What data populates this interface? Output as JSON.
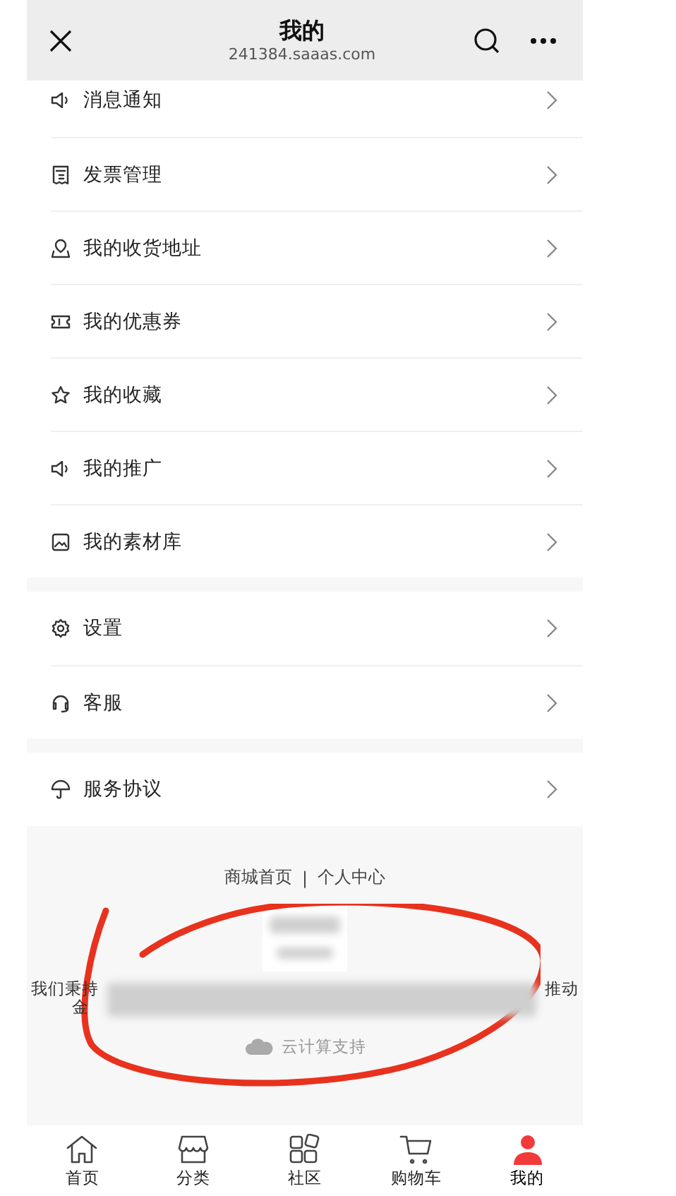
{
  "header": {
    "title": "我的",
    "subtitle": "241384.saaas.com"
  },
  "sections": [
    {
      "items": [
        {
          "label": "消息通知"
        },
        {
          "label": "发票管理"
        },
        {
          "label": "我的收货地址"
        },
        {
          "label": "我的优惠券"
        },
        {
          "label": "我的收藏"
        },
        {
          "label": "我的推广"
        },
        {
          "label": "我的素材库"
        }
      ]
    },
    {
      "items": [
        {
          "label": "设置"
        },
        {
          "label": "客服"
        }
      ]
    },
    {
      "items": [
        {
          "label": "服务协议"
        }
      ]
    }
  ],
  "footer": {
    "links": [
      "商城首页",
      "个人中心"
    ],
    "separator": "|",
    "notice_start": "我们秉持",
    "notice_end": "推动",
    "notice_second_line": "金",
    "powered_by": "云计算支持"
  },
  "tabbar": [
    {
      "label": "首页",
      "selected": false
    },
    {
      "label": "分类",
      "selected": false
    },
    {
      "label": "社区",
      "selected": false
    },
    {
      "label": "购物车",
      "selected": false
    },
    {
      "label": "我的",
      "selected": true
    }
  ]
}
